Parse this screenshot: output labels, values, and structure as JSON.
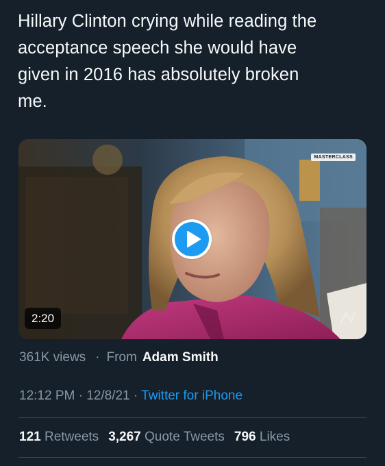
{
  "tweet": {
    "text_line_1": "Hillary Clinton crying while reading the",
    "text_line_2": "acceptance speech she would have",
    "text_line_3": "given in 2016 has absolutely broken",
    "text_line_4": "me."
  },
  "video": {
    "duration": "2:20",
    "watermark": "MASTERCLASS",
    "play_icon": "play-icon"
  },
  "meta": {
    "views": "361K views",
    "separator": "·",
    "from_label": "From",
    "author": "Adam Smith"
  },
  "timestamp": {
    "time": "12:12 PM",
    "sep1": "·",
    "date": "12/8/21",
    "sep2": "·",
    "source": "Twitter for iPhone"
  },
  "stats": {
    "retweets_count": "121",
    "retweets_label": "Retweets",
    "quotes_count": "3,267",
    "quotes_label": "Quote Tweets",
    "likes_count": "796",
    "likes_label": "Likes"
  },
  "colors": {
    "background": "#15202b",
    "text": "#f7f9f9",
    "secondary": "#8b98a5",
    "accent": "#1d9bf0",
    "divider": "#38444d"
  }
}
